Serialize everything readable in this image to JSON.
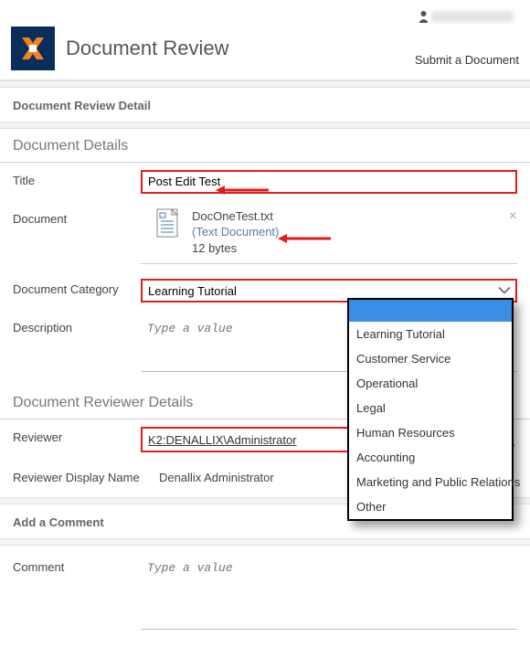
{
  "header": {
    "app_title": "Document Review",
    "submit_link": "Submit a Document"
  },
  "detail_header": "Document Review Detail",
  "document_details": {
    "section_title": "Document Details",
    "title_label": "Title",
    "title_value": "Post Edit Test",
    "doc_label": "Document",
    "doc_filename": "DocOneTest.txt",
    "doc_type": "(Text Document)",
    "doc_size": "12 bytes",
    "category_label": "Document Category",
    "category_value": "Learning Tutorial",
    "category_options": [
      "Learning Tutorial",
      "Customer Service",
      "Operational",
      "Legal",
      "Human Resources",
      "Accounting",
      "Marketing and Public Relations",
      "Other"
    ],
    "description_label": "Description",
    "description_placeholder": "Type a value"
  },
  "reviewer_details": {
    "section_title": "Document Reviewer Details",
    "reviewer_label": "Reviewer",
    "reviewer_value": "K2:DENALLIX\\Administrator",
    "display_name_label": "Reviewer Display Name",
    "display_name_value": "Denallix Administrator"
  },
  "comment_section": {
    "section_title": "Add a Comment",
    "comment_label": "Comment",
    "comment_placeholder": "Type a value"
  }
}
